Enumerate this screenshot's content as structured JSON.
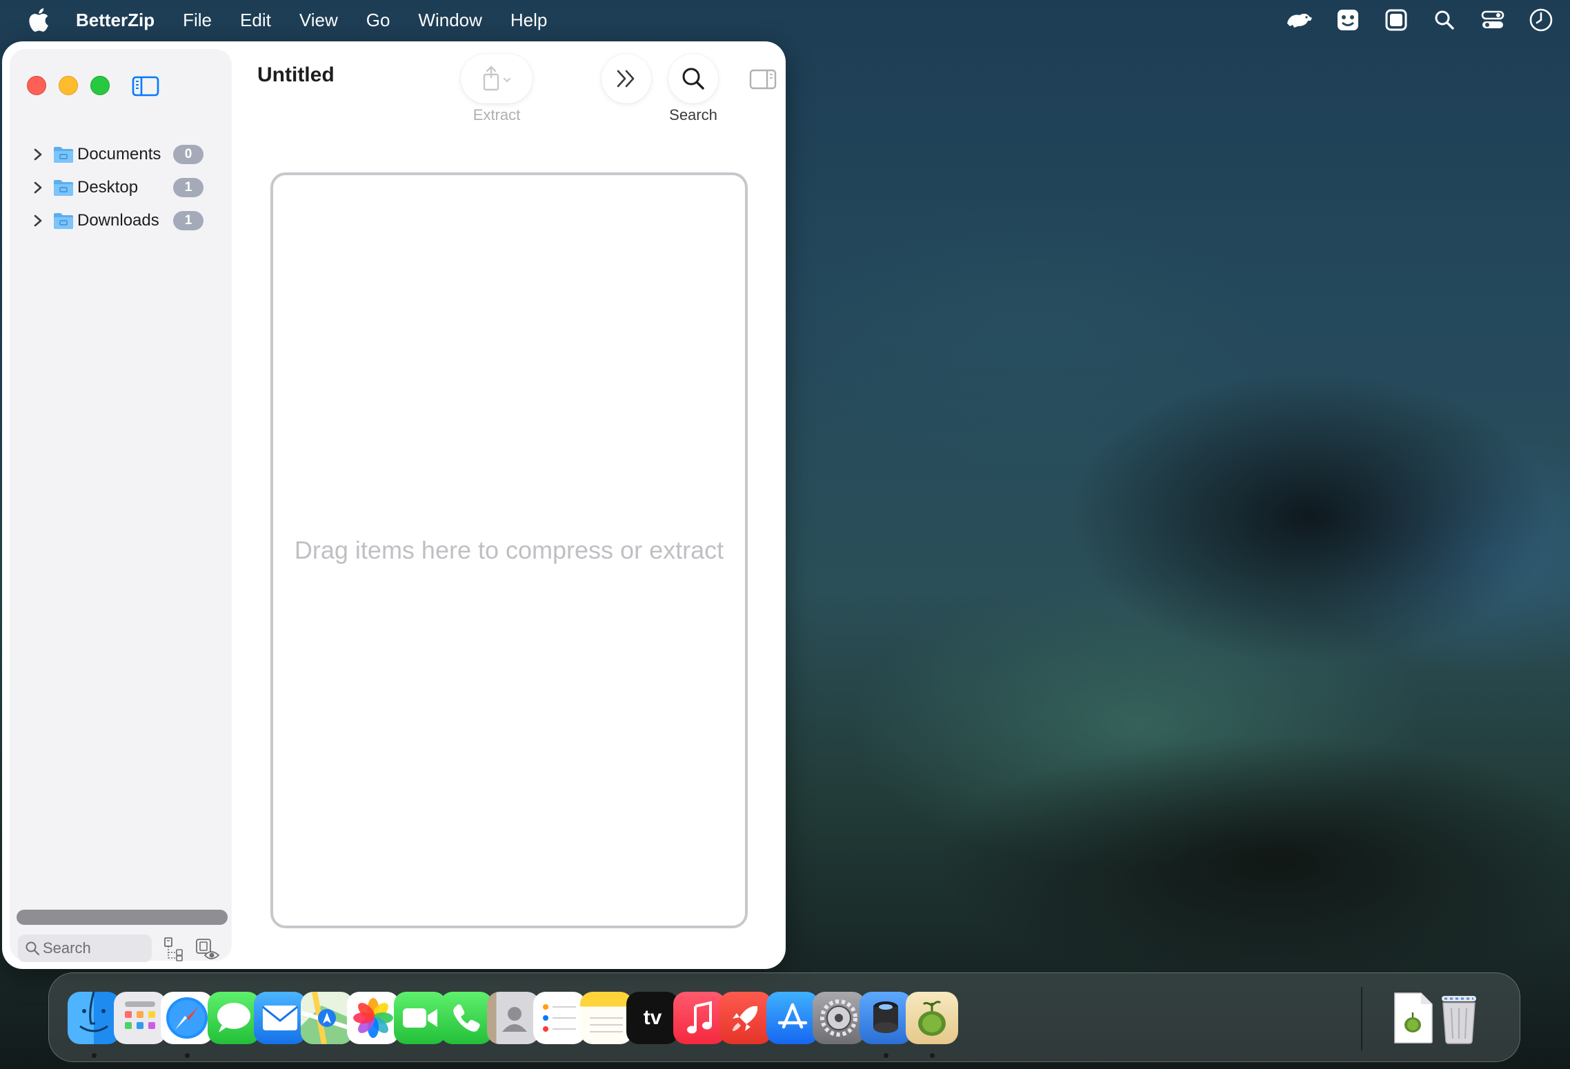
{
  "menubar": {
    "app_name": "BetterZip",
    "items": [
      "File",
      "Edit",
      "View",
      "Go",
      "Window",
      "Help"
    ]
  },
  "window": {
    "title": "Untitled",
    "toolbar": {
      "extract_label": "Extract",
      "search_label": "Search"
    },
    "sidebar": {
      "folders": [
        {
          "name": "Documents",
          "count": "0"
        },
        {
          "name": "Desktop",
          "count": "1"
        },
        {
          "name": "Downloads",
          "count": "1"
        }
      ],
      "search_placeholder": "Search"
    },
    "dropzone_hint": "Drag items here to compress or extract"
  },
  "dock": {
    "apps": [
      "finder",
      "launchpad",
      "safari",
      "messages",
      "mail",
      "maps",
      "photos",
      "facetime",
      "phone",
      "contacts",
      "reminders",
      "notes",
      "tv",
      "music",
      "rocketsim",
      "app-store",
      "system-settings",
      "preview-scanner",
      "betterzip"
    ],
    "running": [
      "finder",
      "safari",
      "preview-scanner",
      "betterzip"
    ],
    "other": [
      "archive-file",
      "trash"
    ],
    "tv_label": "tv"
  },
  "colors": {
    "accent": "#007aff",
    "badge": "#a4aab8",
    "close": "#fe5f57",
    "minimize": "#febc2e",
    "zoom": "#28c840"
  }
}
